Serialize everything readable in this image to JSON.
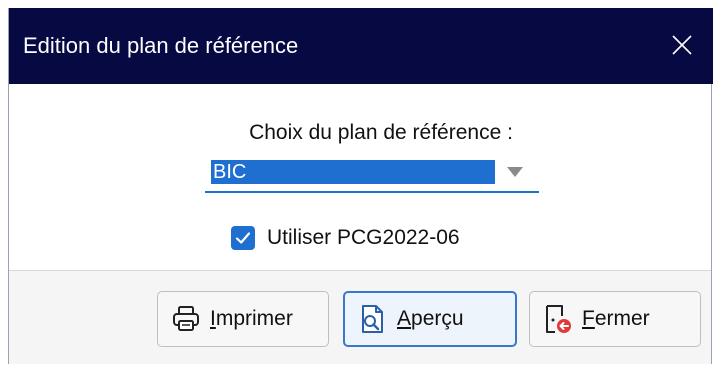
{
  "window": {
    "title": "Edition du plan de référence"
  },
  "form": {
    "plan_label": "Choix du plan de référence :",
    "plan_select": {
      "value": "BIC"
    },
    "use_pcg": {
      "label": "Utiliser PCG2022-06",
      "checked": true
    }
  },
  "buttons": {
    "print": {
      "mnemonic": "I",
      "rest": "mprimer"
    },
    "preview": {
      "mnemonic": "A",
      "rest": "perçu"
    },
    "close": {
      "mnemonic": "F",
      "rest": "ermer"
    }
  },
  "icons": {
    "close": "close-icon",
    "dropdown": "chevron-down-icon",
    "checkbox": "checkmark-icon",
    "print": "printer-icon",
    "preview": "magnifier-document-icon",
    "exit": "exit-door-icon"
  },
  "colors": {
    "titlebar": "#060942",
    "accent": "#1f6fd1",
    "footer": "#f5f5f5",
    "exit_badge": "#e03a3a"
  }
}
